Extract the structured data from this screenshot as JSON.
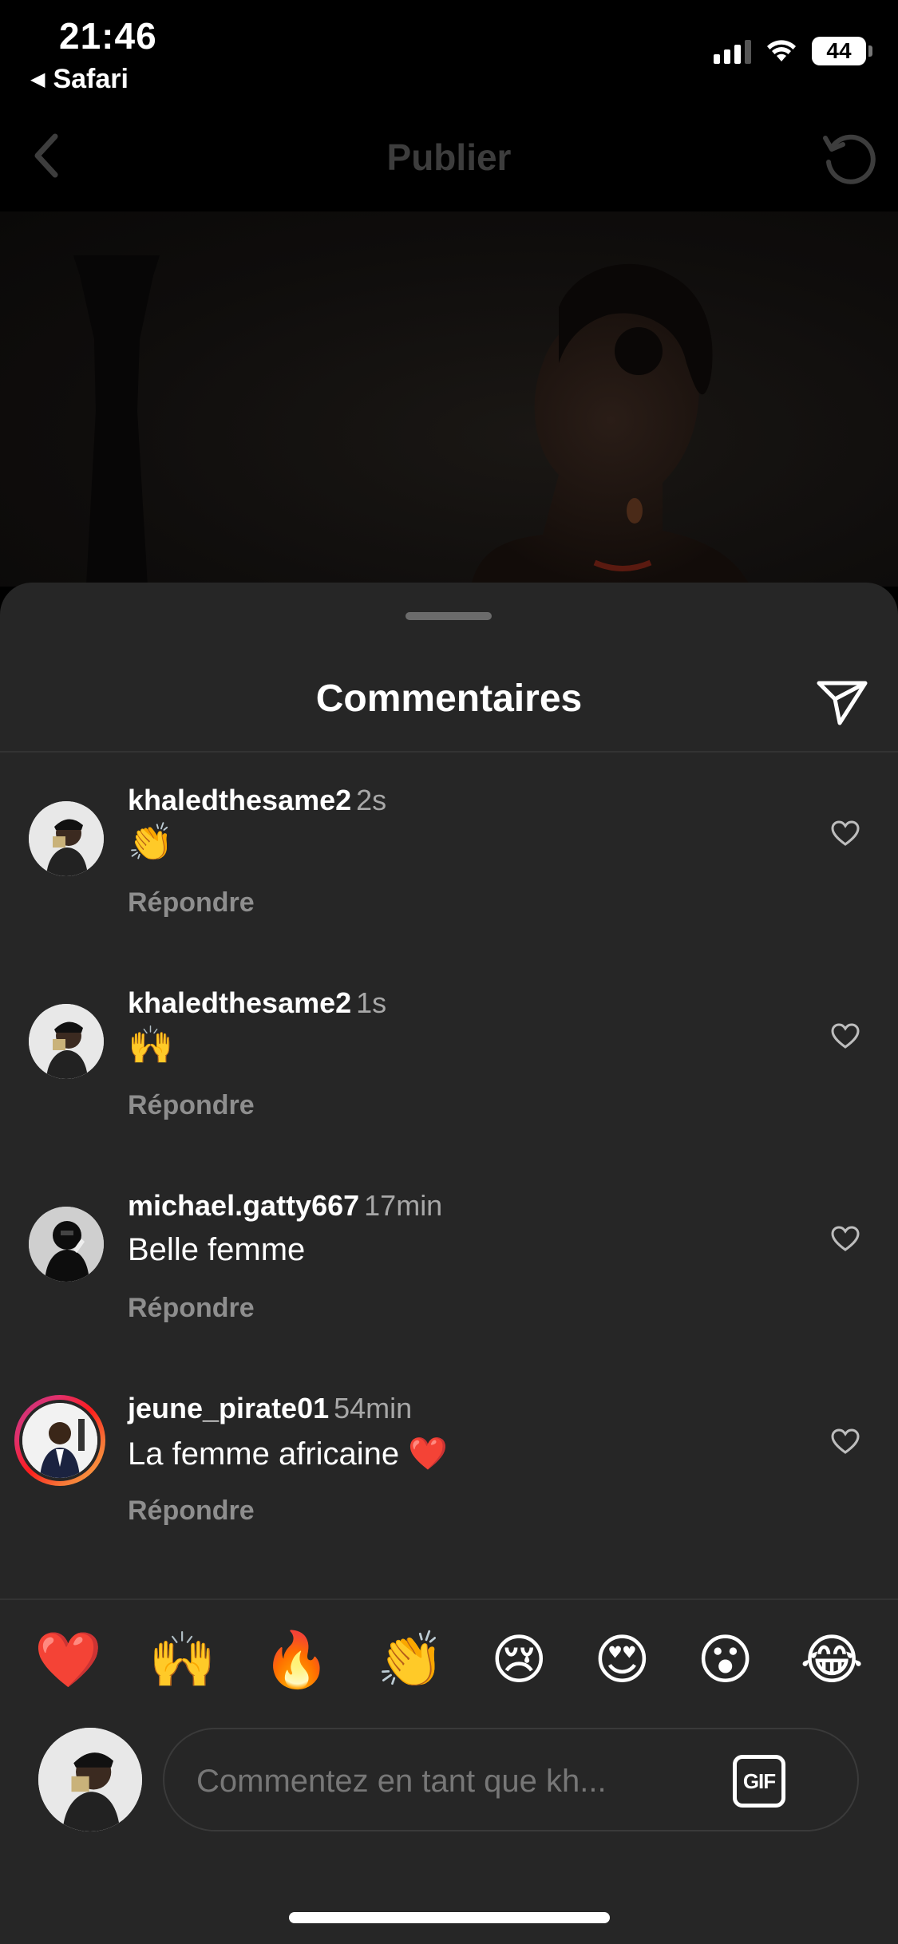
{
  "status_bar": {
    "time": "21:46",
    "back_app": "Safari",
    "battery": "44"
  },
  "nav": {
    "title": "Publier"
  },
  "sheet": {
    "title": "Commentaires",
    "comments": [
      {
        "username": "khaledthesame2",
        "time": "2s",
        "text": "👏",
        "reply_label": "Répondre"
      },
      {
        "username": "khaledthesame2",
        "time": "1s",
        "text": "🙌",
        "reply_label": "Répondre"
      },
      {
        "username": "michael.gatty667",
        "time": "17min",
        "text": "Belle femme",
        "reply_label": "Répondre"
      },
      {
        "username": "jeune_pirate01",
        "time": "54min",
        "text": "La femme africaine ❤️",
        "reply_label": "Répondre"
      }
    ],
    "reactions": [
      "❤️",
      "🙌",
      "🔥",
      "👏",
      "😢",
      "😍",
      "😮",
      "😂"
    ],
    "composer": {
      "placeholder": "Commentez en tant que kh...",
      "gif_label": "GIF"
    }
  },
  "colors": {
    "background": "#000000",
    "sheet": "#262626",
    "secondary_text": "#a8a8a8",
    "reply_text": "#8e8e8e"
  }
}
